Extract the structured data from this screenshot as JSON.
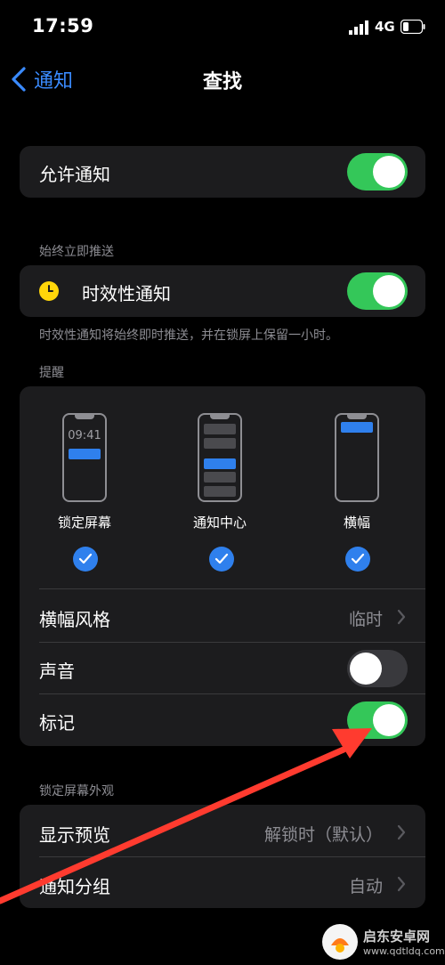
{
  "status": {
    "time": "17:59",
    "network": "4G"
  },
  "nav": {
    "back_label": "通知",
    "title": "查找"
  },
  "allow_notifications": {
    "label": "允许通知",
    "enabled": true
  },
  "immediate": {
    "header": "始终立即推送",
    "time_sensitive_label": "时效性通知",
    "time_sensitive_enabled": true,
    "footnote": "时效性通知将始终即时推送，并在锁屏上保留一小时。"
  },
  "alerts": {
    "header": "提醒",
    "options": [
      {
        "label": "锁定屏幕",
        "preview_time": "09:41",
        "checked": true
      },
      {
        "label": "通知中心",
        "checked": true
      },
      {
        "label": "横幅",
        "checked": true
      }
    ],
    "banner_style": {
      "label": "横幅风格",
      "value": "临时"
    },
    "sounds": {
      "label": "声音",
      "enabled": false
    },
    "badges": {
      "label": "标记",
      "enabled": true
    }
  },
  "lock_screen": {
    "header": "锁定屏幕外观",
    "show_previews": {
      "label": "显示预览",
      "value": "解锁时（默认）"
    },
    "grouping": {
      "label": "通知分组",
      "value": "自动"
    }
  },
  "watermark": {
    "name": "启东安卓网",
    "url": "www.qdtldq.com"
  },
  "colors": {
    "accent": "#2f80ed",
    "toggle_on": "#34c759",
    "arrow": "#ff3b2f"
  }
}
